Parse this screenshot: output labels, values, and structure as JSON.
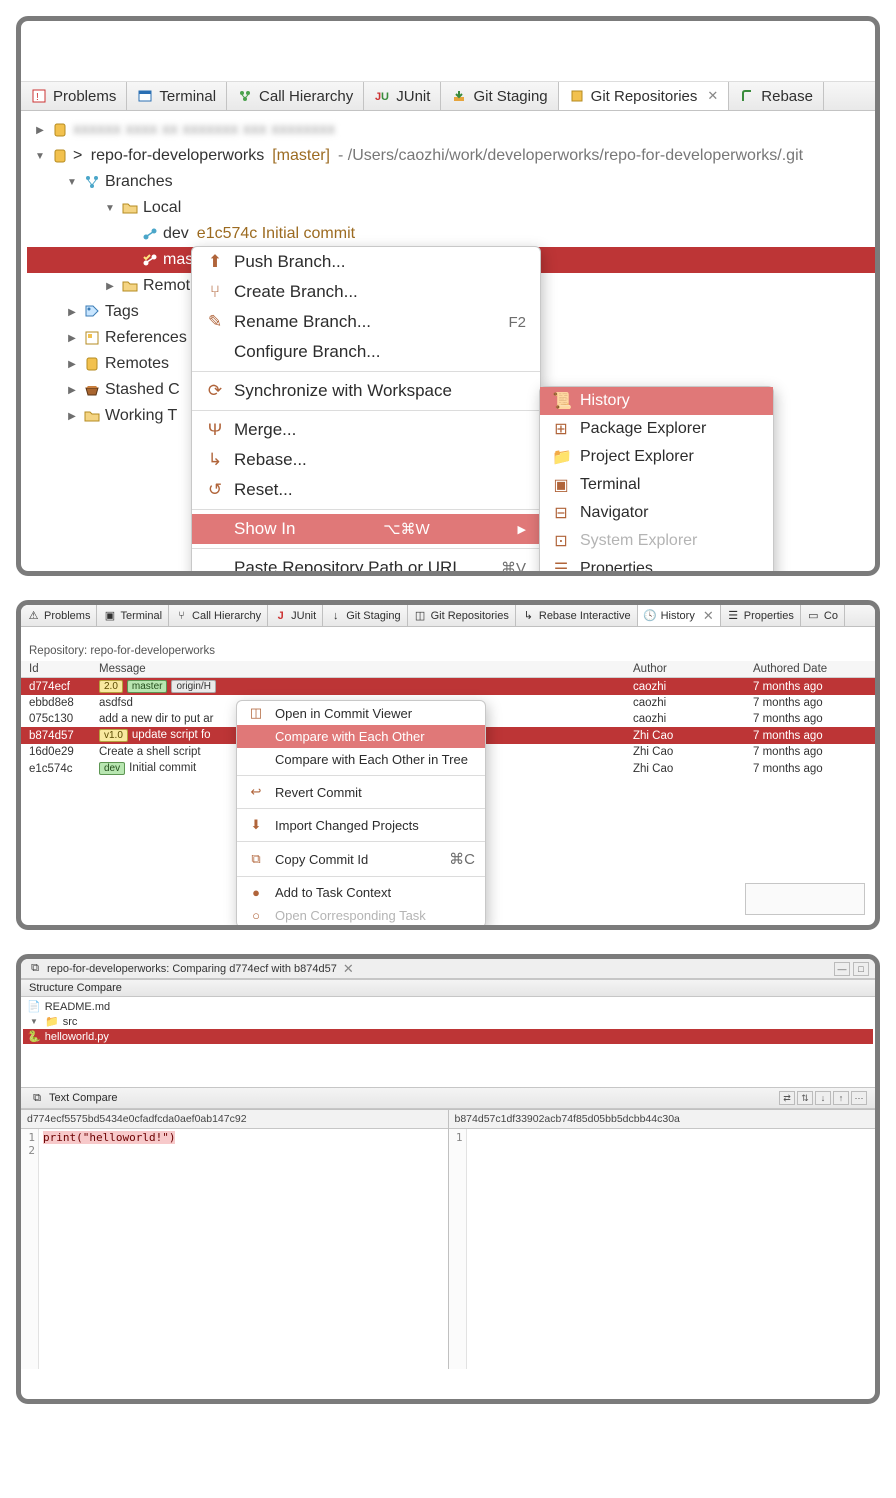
{
  "panel1": {
    "tabs": [
      "Problems",
      "Terminal",
      "Call Hierarchy",
      "JUnit",
      "Git Staging",
      "Git Repositories",
      "Rebase"
    ],
    "active_tab": "Git Repositories",
    "tree": {
      "repo": {
        "name": "repo-for-developerworks",
        "branch_decor": "[master]",
        "path": "- /Users/caozhi/work/developerworks/repo-for-developerworks/.git"
      },
      "branches_label": "Branches",
      "local_label": "Local",
      "dev_label": "dev",
      "dev_commit": "e1c574c Initial commit",
      "master_label": "mas",
      "remote_label": "Remot",
      "tags_label": "Tags",
      "references_label": "References",
      "remotes_label": "Remotes",
      "stashed_label": "Stashed C",
      "working_label": "Working T"
    },
    "ctx1": {
      "push": "Push Branch...",
      "create": "Create Branch...",
      "rename": "Rename Branch...",
      "rename_kbd": "F2",
      "configure": "Configure Branch...",
      "sync": "Synchronize with Workspace",
      "merge": "Merge...",
      "rebase": "Rebase...",
      "reset": "Reset...",
      "showin": "Show In",
      "showin_kbd": "⌥⌘W",
      "paste": "Paste Repository Path or URI",
      "paste_kbd": "⌘V"
    },
    "ctx2": {
      "history": "History",
      "pkg": "Package Explorer",
      "prj": "Project Explorer",
      "term": "Terminal",
      "nav": "Navigator",
      "sys": "System Explorer",
      "prop": "Properties"
    }
  },
  "panel2": {
    "tabs": [
      "Problems",
      "Terminal",
      "Call Hierarchy",
      "JUnit",
      "Git Staging",
      "Git Repositories",
      "Rebase Interactive",
      "History",
      "Properties",
      "Co"
    ],
    "active_tab": "History",
    "repo_label": "Repository: repo-for-developerworks",
    "columns": [
      "Id",
      "Message",
      "Author",
      "Authored Date"
    ],
    "rows": [
      {
        "id": "d774ecf",
        "pills": [
          "2.0",
          "master",
          "origin/H"
        ],
        "msg": "",
        "author": "caozhi",
        "date": "7 months ago",
        "sel": true
      },
      {
        "id": "ebbd8e8",
        "pills": [],
        "msg": "asdfsd",
        "author": "caozhi",
        "date": "7 months ago",
        "sel": false
      },
      {
        "id": "075c130",
        "pills": [],
        "msg": "add a new dir to put ar",
        "author": "caozhi",
        "date": "7 months ago",
        "sel": false
      },
      {
        "id": "b874d57",
        "pills": [
          "v1.0"
        ],
        "msg": "update script fo",
        "author": "Zhi Cao",
        "date": "7 months ago",
        "sel": true
      },
      {
        "id": "16d0e29",
        "pills": [],
        "msg": "Create a shell script",
        "author": "Zhi Cao",
        "date": "7 months ago",
        "sel": false
      },
      {
        "id": "e1c574c",
        "pills": [
          "dev"
        ],
        "msg": "Initial commit",
        "author": "Zhi Cao",
        "date": "7 months ago",
        "sel": false
      }
    ],
    "ctx3": {
      "open": "Open in Commit Viewer",
      "cmp": "Compare with Each Other",
      "cmptree": "Compare with Each Other in Tree",
      "revert": "Revert Commit",
      "import": "Import Changed Projects",
      "copyid": "Copy Commit Id",
      "copyid_kbd": "⌘C",
      "task": "Add to Task Context",
      "opentask": "Open Corresponding Task"
    }
  },
  "panel3": {
    "title": "repo-for-developerworks: Comparing d774ecf with b874d57",
    "struct_hdr": "Structure Compare",
    "files": {
      "readme": "README.md",
      "src": "src",
      "hello": "helloworld.py"
    },
    "text_hdr": "Text Compare",
    "left_hdr": "d774ecf5575bd5434e0cfadfcda0aef0ab147c92",
    "right_hdr": "b874d57c1df33902acb74f85d05bb5dcbb44c30a",
    "left_lines": [
      "print(\"helloworld!\")",
      ""
    ],
    "right_lines": [
      ""
    ]
  }
}
